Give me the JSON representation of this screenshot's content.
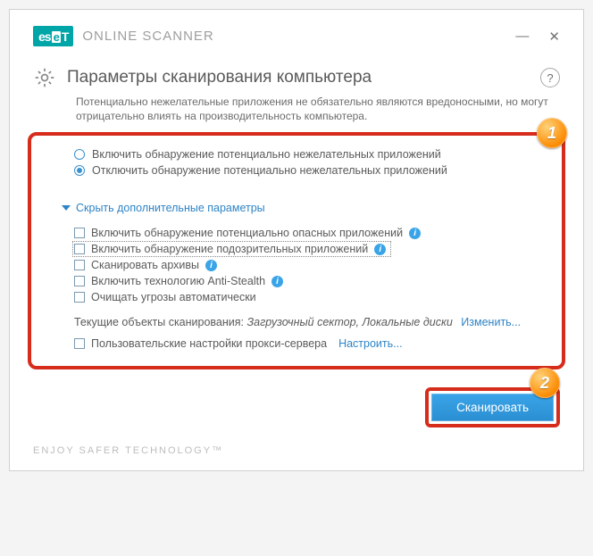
{
  "brand": {
    "logo_left": "es",
    "logo_mid": "e",
    "logo_right": "T",
    "app_title": "ONLINE SCANNER"
  },
  "window": {
    "minimize": "—",
    "close": "✕"
  },
  "page": {
    "title": "Параметры сканирования компьютера",
    "help": "?",
    "intro": "Потенциально нежелательные приложения не обязательно являются вредоносными, но могут отрицательно влиять на производительность компьютера."
  },
  "badges": {
    "one": "1",
    "two": "2"
  },
  "radios": {
    "enable": "Включить обнаружение потенциально нежелательных приложений",
    "disable": "Отключить обнаружение потенциально нежелательных приложений",
    "selected": "disable"
  },
  "toggle": "Скрыть дополнительные параметры",
  "checks": [
    {
      "label": "Включить обнаружение потенциально опасных приложений",
      "info": true,
      "dotted": false
    },
    {
      "label": "Включить обнаружение подозрительных приложений",
      "info": true,
      "dotted": true
    },
    {
      "label": "Сканировать архивы",
      "info": true,
      "dotted": false
    },
    {
      "label": "Включить технологию Anti-Stealth",
      "info": true,
      "dotted": false
    },
    {
      "label": "Очищать угрозы автоматически",
      "info": false,
      "dotted": false
    }
  ],
  "targets": {
    "label": "Текущие объекты сканирования:",
    "value": "Загрузочный сектор, Локальные диски",
    "change": "Изменить..."
  },
  "proxy": {
    "label": "Пользовательские настройки прокси-сервера",
    "configure": "Настроить..."
  },
  "scan_button": "Сканировать",
  "footer": "ENJOY SAFER TECHNOLOGY™"
}
